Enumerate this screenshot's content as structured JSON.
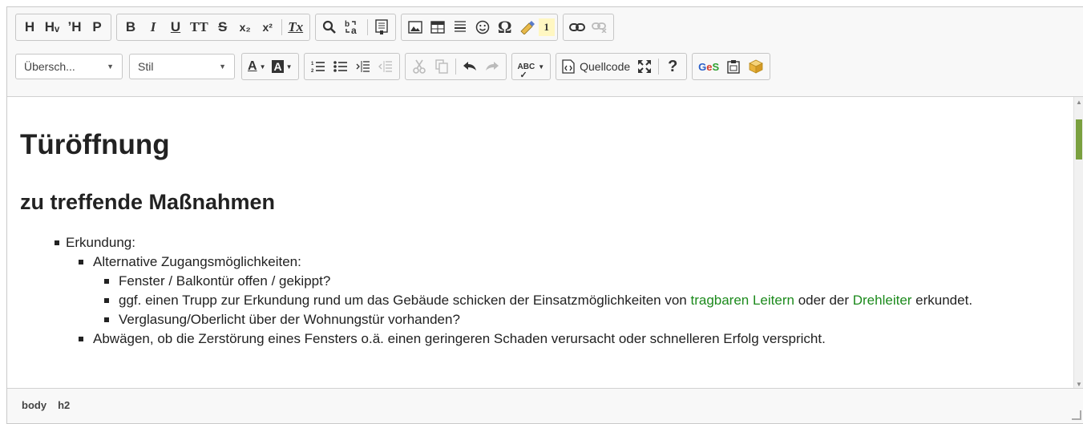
{
  "toolbar": {
    "row1": {
      "headings": [
        "H",
        "Hᵥ",
        "ʼH",
        "P"
      ],
      "format": [
        "B",
        "I",
        "U",
        "TT",
        "S",
        "x₂",
        "x²",
        "Tx"
      ],
      "find_icons": [
        "find-icon",
        "replace-icon",
        "paste-text-icon"
      ],
      "insert_icons": [
        "image-icon",
        "table-icon",
        "horizontal-rule-icon",
        "smiley-icon",
        "special-char-icon",
        "marker-icon",
        "footnote-icon"
      ],
      "special_char": "Ω",
      "footnote": "1",
      "link_icons": [
        "link-icon",
        "unlink-icon"
      ]
    },
    "row2": {
      "heading_combo": "Übersch...",
      "style_combo": "Stil",
      "text_color": "A",
      "bg_color": "A",
      "list_icons": [
        "numbered-list-icon",
        "bulleted-list-icon",
        "indent-icon",
        "outdent-icon"
      ],
      "edit_icons": [
        "cut-icon",
        "copy-icon",
        "undo-icon",
        "redo-icon"
      ],
      "spell": "ABC",
      "source_label": "Quellcode",
      "help": "?",
      "ges": "GeS"
    }
  },
  "content": {
    "title": "Türöffnung",
    "subtitle": "zu treffende Maßnahmen",
    "items": {
      "a": "Erkundung:",
      "b": "Alternative Zugangsmöglichkeiten:",
      "c": "Fenster / Balkontür offen / gekippt?",
      "d_pre": "ggf. einen Trupp zur Erkundung rund um das Gebäude schicken der Einsatzmöglichkeiten von ",
      "d_link1": "tragbaren Leitern",
      "d_mid": " oder der ",
      "d_link2": "Drehleiter",
      "d_post": " erkundet.",
      "e": "Verglasung/Oberlicht über der Wohnungstür vorhanden?",
      "f": "Abwägen, ob die Zerstörung eines Fensters o.ä. einen geringeren Schaden verursacht oder schnelleren Erfolg verspricht."
    }
  },
  "status": {
    "path": [
      "body",
      "h2"
    ]
  },
  "colors": {
    "link": "#1c8a1c",
    "scroll_thumb": "#7aa03f"
  }
}
